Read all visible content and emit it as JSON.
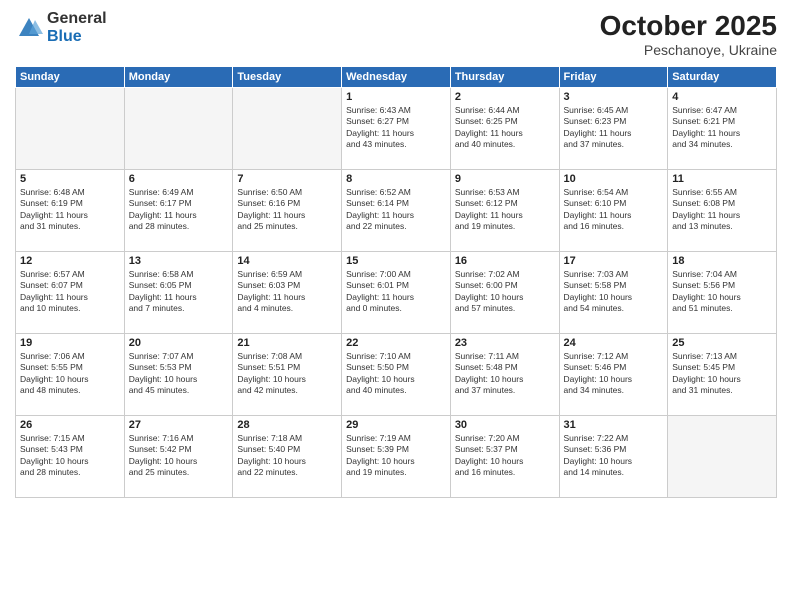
{
  "header": {
    "logo_general": "General",
    "logo_blue": "Blue",
    "month": "October 2025",
    "location": "Peschanoye, Ukraine"
  },
  "weekdays": [
    "Sunday",
    "Monday",
    "Tuesday",
    "Wednesday",
    "Thursday",
    "Friday",
    "Saturday"
  ],
  "weeks": [
    [
      {
        "day": "",
        "text": ""
      },
      {
        "day": "",
        "text": ""
      },
      {
        "day": "",
        "text": ""
      },
      {
        "day": "1",
        "text": "Sunrise: 6:43 AM\nSunset: 6:27 PM\nDaylight: 11 hours\nand 43 minutes."
      },
      {
        "day": "2",
        "text": "Sunrise: 6:44 AM\nSunset: 6:25 PM\nDaylight: 11 hours\nand 40 minutes."
      },
      {
        "day": "3",
        "text": "Sunrise: 6:45 AM\nSunset: 6:23 PM\nDaylight: 11 hours\nand 37 minutes."
      },
      {
        "day": "4",
        "text": "Sunrise: 6:47 AM\nSunset: 6:21 PM\nDaylight: 11 hours\nand 34 minutes."
      }
    ],
    [
      {
        "day": "5",
        "text": "Sunrise: 6:48 AM\nSunset: 6:19 PM\nDaylight: 11 hours\nand 31 minutes."
      },
      {
        "day": "6",
        "text": "Sunrise: 6:49 AM\nSunset: 6:17 PM\nDaylight: 11 hours\nand 28 minutes."
      },
      {
        "day": "7",
        "text": "Sunrise: 6:50 AM\nSunset: 6:16 PM\nDaylight: 11 hours\nand 25 minutes."
      },
      {
        "day": "8",
        "text": "Sunrise: 6:52 AM\nSunset: 6:14 PM\nDaylight: 11 hours\nand 22 minutes."
      },
      {
        "day": "9",
        "text": "Sunrise: 6:53 AM\nSunset: 6:12 PM\nDaylight: 11 hours\nand 19 minutes."
      },
      {
        "day": "10",
        "text": "Sunrise: 6:54 AM\nSunset: 6:10 PM\nDaylight: 11 hours\nand 16 minutes."
      },
      {
        "day": "11",
        "text": "Sunrise: 6:55 AM\nSunset: 6:08 PM\nDaylight: 11 hours\nand 13 minutes."
      }
    ],
    [
      {
        "day": "12",
        "text": "Sunrise: 6:57 AM\nSunset: 6:07 PM\nDaylight: 11 hours\nand 10 minutes."
      },
      {
        "day": "13",
        "text": "Sunrise: 6:58 AM\nSunset: 6:05 PM\nDaylight: 11 hours\nand 7 minutes."
      },
      {
        "day": "14",
        "text": "Sunrise: 6:59 AM\nSunset: 6:03 PM\nDaylight: 11 hours\nand 4 minutes."
      },
      {
        "day": "15",
        "text": "Sunrise: 7:00 AM\nSunset: 6:01 PM\nDaylight: 11 hours\nand 0 minutes."
      },
      {
        "day": "16",
        "text": "Sunrise: 7:02 AM\nSunset: 6:00 PM\nDaylight: 10 hours\nand 57 minutes."
      },
      {
        "day": "17",
        "text": "Sunrise: 7:03 AM\nSunset: 5:58 PM\nDaylight: 10 hours\nand 54 minutes."
      },
      {
        "day": "18",
        "text": "Sunrise: 7:04 AM\nSunset: 5:56 PM\nDaylight: 10 hours\nand 51 minutes."
      }
    ],
    [
      {
        "day": "19",
        "text": "Sunrise: 7:06 AM\nSunset: 5:55 PM\nDaylight: 10 hours\nand 48 minutes."
      },
      {
        "day": "20",
        "text": "Sunrise: 7:07 AM\nSunset: 5:53 PM\nDaylight: 10 hours\nand 45 minutes."
      },
      {
        "day": "21",
        "text": "Sunrise: 7:08 AM\nSunset: 5:51 PM\nDaylight: 10 hours\nand 42 minutes."
      },
      {
        "day": "22",
        "text": "Sunrise: 7:10 AM\nSunset: 5:50 PM\nDaylight: 10 hours\nand 40 minutes."
      },
      {
        "day": "23",
        "text": "Sunrise: 7:11 AM\nSunset: 5:48 PM\nDaylight: 10 hours\nand 37 minutes."
      },
      {
        "day": "24",
        "text": "Sunrise: 7:12 AM\nSunset: 5:46 PM\nDaylight: 10 hours\nand 34 minutes."
      },
      {
        "day": "25",
        "text": "Sunrise: 7:13 AM\nSunset: 5:45 PM\nDaylight: 10 hours\nand 31 minutes."
      }
    ],
    [
      {
        "day": "26",
        "text": "Sunrise: 7:15 AM\nSunset: 5:43 PM\nDaylight: 10 hours\nand 28 minutes."
      },
      {
        "day": "27",
        "text": "Sunrise: 7:16 AM\nSunset: 5:42 PM\nDaylight: 10 hours\nand 25 minutes."
      },
      {
        "day": "28",
        "text": "Sunrise: 7:18 AM\nSunset: 5:40 PM\nDaylight: 10 hours\nand 22 minutes."
      },
      {
        "day": "29",
        "text": "Sunrise: 7:19 AM\nSunset: 5:39 PM\nDaylight: 10 hours\nand 19 minutes."
      },
      {
        "day": "30",
        "text": "Sunrise: 7:20 AM\nSunset: 5:37 PM\nDaylight: 10 hours\nand 16 minutes."
      },
      {
        "day": "31",
        "text": "Sunrise: 7:22 AM\nSunset: 5:36 PM\nDaylight: 10 hours\nand 14 minutes."
      },
      {
        "day": "",
        "text": ""
      }
    ]
  ]
}
